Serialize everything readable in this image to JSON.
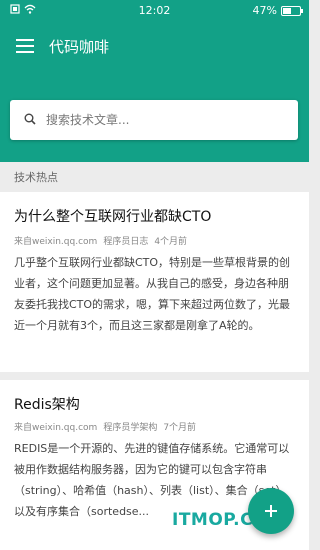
{
  "status_bar": {
    "time": "12:02",
    "battery_text": "47%",
    "battery_level": 0.47
  },
  "app": {
    "title": "代码咖啡"
  },
  "search": {
    "placeholder": "搜索技术文章..."
  },
  "section": {
    "title": "技术热点"
  },
  "articles": [
    {
      "title": "为什么整个互联网行业都缺CTO",
      "source": "来自weixin.qq.com",
      "author": "程序员日志",
      "time": "4个月前",
      "summary": "几乎整个互联网行业都缺CTO，特别是一些草根背景的创业者，这个问题更加显著。从我自己的感受，身边各种朋友委托我找CTO的需求，嗯，算下来超过两位数了，光最近一个月就有3个，而且这三家都是刚拿了A轮的。"
    },
    {
      "title": "Redis架构",
      "source": "来自weixin.qq.com",
      "author": "程序员学架构",
      "time": "7个月前",
      "summary": "REDIS是一个开源的、先进的键值存储系统。它通常可以被用作数据结构服务器，因为它的键可以包含字符串（string）、哈希值（hash）、列表（list）、集合（set）以及有序集合（sortedse..."
    }
  ],
  "watermark": "ITMOP.COM",
  "colors": {
    "primary": "#12a187"
  }
}
